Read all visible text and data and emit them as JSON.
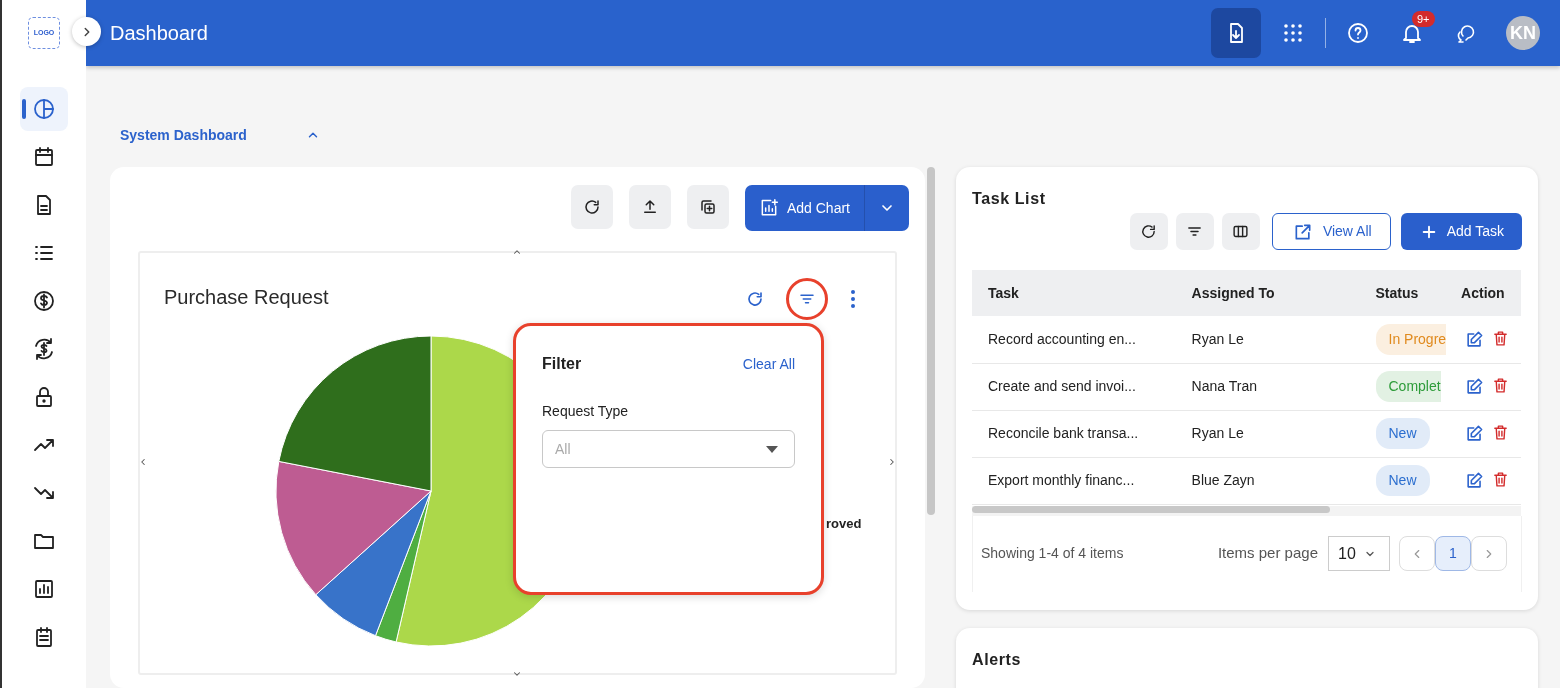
{
  "sidebar": {
    "logo": "LOGO",
    "items": [
      {
        "kind": "pie",
        "selected": true
      },
      {
        "kind": "calendar",
        "selected": false
      },
      {
        "kind": "document",
        "selected": false
      },
      {
        "kind": "list",
        "selected": false
      },
      {
        "kind": "dollar",
        "selected": false
      },
      {
        "kind": "dollar-sync",
        "selected": false
      },
      {
        "kind": "lock",
        "selected": false
      },
      {
        "kind": "trend-up",
        "selected": false
      },
      {
        "kind": "trend-down",
        "selected": false
      },
      {
        "kind": "folder",
        "selected": false
      },
      {
        "kind": "bar-chart",
        "selected": false
      },
      {
        "kind": "notes",
        "selected": false
      }
    ]
  },
  "header": {
    "title": "Dashboard",
    "notification_count": "9+",
    "avatar_initials": "KN"
  },
  "section": {
    "title": "System Dashboard",
    "expanded": true
  },
  "chart_toolbar": {
    "add_button": "Add Chart"
  },
  "widget": {
    "title": "Purchase Request",
    "filter_highlighted": true,
    "legend_label": "roved"
  },
  "filter_popup": {
    "highlighted": true,
    "title": "Filter",
    "clear": "Clear All",
    "field_label": "Request Type",
    "placeholder": "All"
  },
  "task_list": {
    "title": "Task List",
    "view_all": "View All",
    "add": "Add Task",
    "columns": [
      "Task",
      "Assigned To",
      "Status",
      "Action"
    ],
    "rows": [
      {
        "task": "Record accounting en...",
        "assignee": "Ryan Le",
        "status": "In Progre",
        "color": "#e08a1e"
      },
      {
        "task": "Create and send invoi...",
        "assignee": "Nana Tran",
        "status": "Complet",
        "color": "#2e9c3a"
      },
      {
        "task": "Reconcile bank transa...",
        "assignee": "Ryan Le",
        "status": "New",
        "color": "#2b6ecf"
      },
      {
        "task": "Export monthly financ...",
        "assignee": "Blue Zayn",
        "status": "New",
        "color": "#2b6ecf"
      }
    ],
    "footer": "Showing 1-4 of 4 items",
    "per_page_label": "Items per page",
    "per_page": "10",
    "pages": [
      {
        "label": "1",
        "selected": true
      }
    ]
  },
  "alerts": {
    "title": "Alerts"
  }
}
